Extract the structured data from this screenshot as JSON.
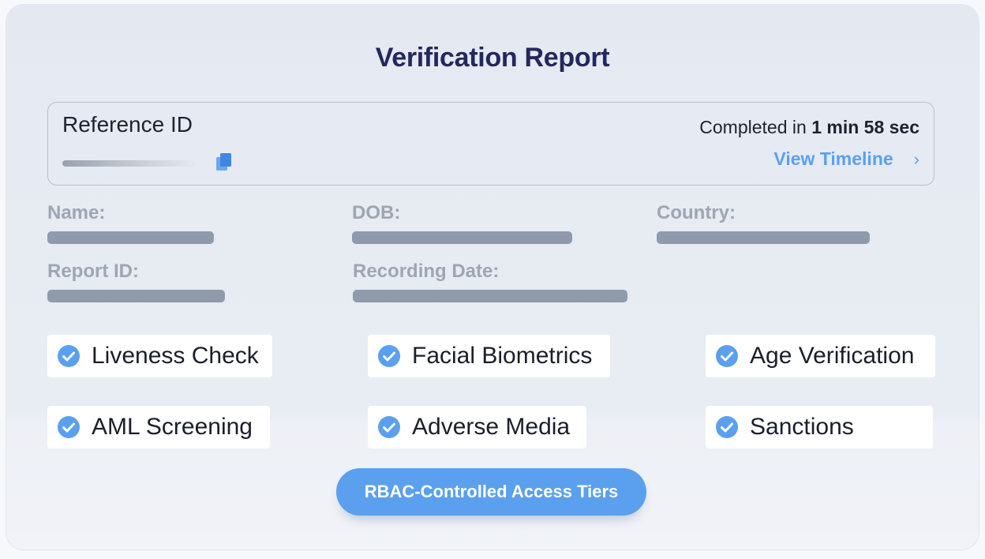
{
  "report": {
    "title": "Verification Report",
    "reference": {
      "label": "Reference ID",
      "completed_prefix": "Completed in ",
      "completed_duration": "1 min 58 sec",
      "view_timeline": "View Timeline",
      "chevron": "›"
    },
    "fields": [
      {
        "label": "Name:"
      },
      {
        "label": "DOB:"
      },
      {
        "label": "Country:"
      },
      {
        "label": "Report ID:"
      },
      {
        "label": "Recording Date:"
      }
    ],
    "checks": [
      {
        "label": "Liveness Check",
        "icon": "check-circle-icon"
      },
      {
        "label": "Facial Biometrics",
        "icon": "check-circle-icon"
      },
      {
        "label": "Age Verification",
        "icon": "check-circle-icon"
      },
      {
        "label": "AML Screening",
        "icon": "check-circle-icon"
      },
      {
        "label": "Adverse Media",
        "icon": "check-circle-icon"
      },
      {
        "label": "Sanctions",
        "icon": "check-circle-icon"
      }
    ],
    "cta_label": "RBAC-Controlled Access Tiers"
  },
  "colors": {
    "accent": "#5aa0ee",
    "title": "#23285c",
    "field_label": "#9ea6b3",
    "redaction_bar": "#8f9bac"
  }
}
